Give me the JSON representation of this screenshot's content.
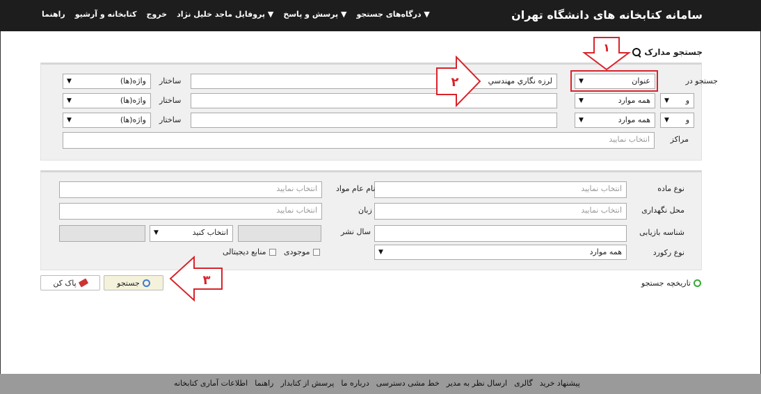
{
  "header": {
    "site_title": "سامانه کتابخانه های دانشگاه تهران",
    "nav": [
      "درگاه‌های جستجو ▼",
      "پرسش و پاسخ ▼",
      "پروفایل ماجد خلیل نژاد ▼",
      "خروج",
      "کتابخانه و آرشیو",
      "راهنما"
    ]
  },
  "page": {
    "title": "جستجو مدارک",
    "search_in_label": "جستجو در",
    "centers_label": "مراکز",
    "structure_label": "ساختار",
    "rows": [
      {
        "operator": "",
        "field": "عنوان",
        "query": "لرزه نگاري مهندسي",
        "structure": "واژه(ها)"
      },
      {
        "operator": "و",
        "field": "همه موارد",
        "query": "",
        "structure": "واژه(ها)"
      },
      {
        "operator": "و",
        "field": "همه موارد",
        "query": "",
        "structure": "واژه(ها)"
      }
    ],
    "centers_placeholder": "انتخاب نمایید"
  },
  "filters": {
    "material_type_label": "نوع ماده",
    "general_material_label": "نام عام مواد",
    "location_label": "محل نگهداری",
    "language_label": "زبان",
    "retrieval_id_label": "شناسه بازیابی",
    "pub_year_label": "سال نشر",
    "record_type_label": "نوع رکورد",
    "placeholder": "انتخاب نمایید",
    "select_placeholder": "انتخاب کنید",
    "record_type_value": "همه موارد",
    "available_label": "موجودی",
    "digital_label": "منابع دیجیتالی"
  },
  "actions": {
    "search_label": "جستجو",
    "clear_label": "پاک کن",
    "history_label": "تاریخچه جستجو"
  },
  "footer": {
    "links": [
      "پیشنهاد خرید",
      "گالری",
      "ارسال نظر به مدیر",
      "خط مشی دسترسی",
      "درباره ما",
      "پرسش از کتابدار",
      "راهنما",
      "اطلاعات آماری کتابخانه"
    ]
  },
  "annotations": {
    "one": "۱",
    "two": "۲",
    "three": "۳",
    "color": "#d8232a"
  }
}
